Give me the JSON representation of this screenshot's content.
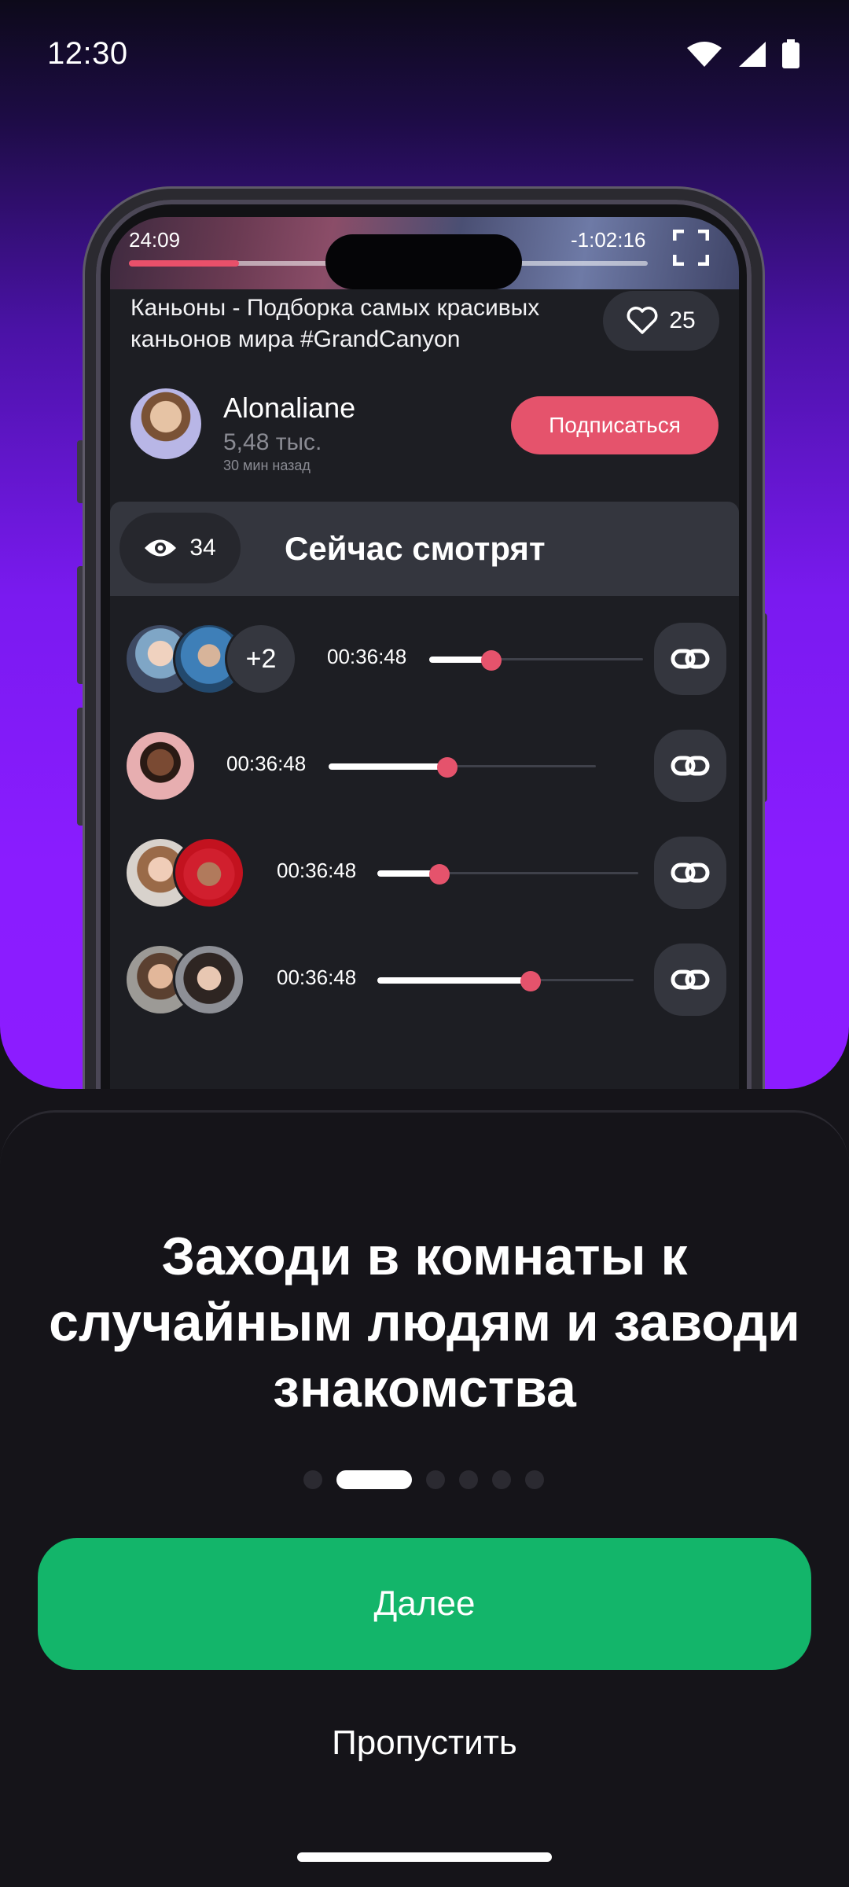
{
  "status_bar": {
    "time": "12:30",
    "icons": [
      "wifi-icon",
      "signal-icon",
      "battery-icon"
    ]
  },
  "video": {
    "elapsed": "24:09",
    "remaining": "-1:02:16",
    "progress": 0.14,
    "title": "Каньоны - Подборка самых красивых каньонов мира #GrandCanyon",
    "likes": "25"
  },
  "author": {
    "name": "Alonaliane",
    "subscribers": "5,48 тыс.",
    "posted": "30 мин назад",
    "subscribe_label": "Подписаться"
  },
  "watching": {
    "viewers": "34",
    "title": "Сейчас смотрят",
    "rooms": [
      {
        "time": "00:36:48",
        "progress": 0.24,
        "extra": "+2"
      },
      {
        "time": "00:36:48",
        "progress": 0.45
      },
      {
        "time": "00:36:48",
        "progress": 0.24
      },
      {
        "time": "00:36:48",
        "progress": 0.6
      }
    ]
  },
  "onboarding": {
    "heading": "Заходи в комнаты к случайным людям и заводи знакомства",
    "page_index": 1,
    "page_count": 6,
    "next_label": "Далее",
    "skip_label": "Пропустить"
  },
  "colors": {
    "accent_pink": "#e5536c",
    "primary_green": "#13b56a",
    "hero_purple": "#8c1cff",
    "background": "#151419"
  }
}
